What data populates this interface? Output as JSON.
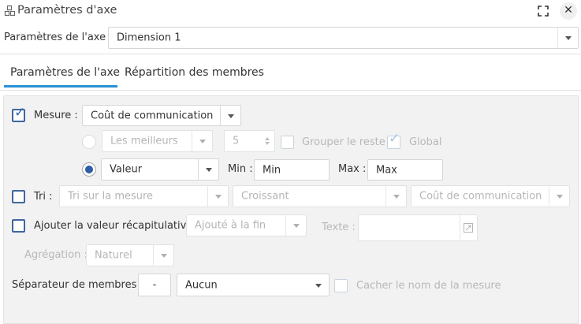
{
  "window": {
    "title": "Paramètres d'axe",
    "title_icon": "cubes-icon"
  },
  "axis": {
    "label": "Paramètres de l'axe :",
    "value": "Dimension 1"
  },
  "tabs": [
    {
      "label": "Paramètres de l'axe",
      "active": true
    },
    {
      "label": "Répartition des membres",
      "active": false
    }
  ],
  "measure": {
    "checkbox_label": "Mesure :",
    "checked": true,
    "value": "Coût de communication",
    "top_option": {
      "value": "Les meilleurs",
      "count": "5",
      "group_rest_label": "Grouper le reste",
      "global_label": "Global",
      "global_checked": true
    },
    "value_option": {
      "value": "Valeur",
      "min_label": "Min :",
      "min_value": "Min",
      "max_label": "Max :",
      "max_value": "Max"
    }
  },
  "sort": {
    "checkbox_label": "Tri :",
    "checked": false,
    "by": "Tri sur la mesure",
    "order": "Croissant",
    "measure": "Coût de communication"
  },
  "summary": {
    "checkbox_label": "Ajouter la valeur récapitulative",
    "checked": false,
    "position": "Ajouté à la fin",
    "text_label": "Texte :",
    "aggregation_label": "Agrégation :",
    "aggregation": "Naturel"
  },
  "separator": {
    "label": "Séparateur de membres :",
    "char": "-",
    "value": "Aucun",
    "hide_measure_label": "Cacher le nom de la mesure"
  },
  "colors": {
    "accent": "#2b8fd6",
    "checkbox": "#3f66a0",
    "radio": "#2d5ea6"
  }
}
